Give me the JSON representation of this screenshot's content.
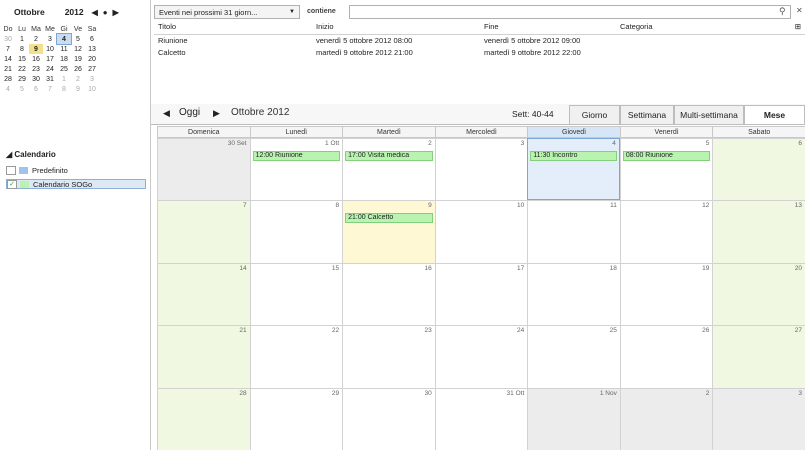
{
  "mini_cal": {
    "month": "Ottobre",
    "year": "2012",
    "weekdays": [
      "Do",
      "Lu",
      "Ma",
      "Me",
      "Gi",
      "Ve",
      "Sa"
    ],
    "rows": [
      [
        "30",
        "1",
        "2",
        "3",
        "4",
        "5",
        "6"
      ],
      [
        "7",
        "8",
        "9",
        "10",
        "11",
        "12",
        "13"
      ],
      [
        "14",
        "15",
        "16",
        "17",
        "18",
        "19",
        "20"
      ],
      [
        "21",
        "22",
        "23",
        "24",
        "25",
        "26",
        "27"
      ],
      [
        "28",
        "29",
        "30",
        "31",
        "1",
        "2",
        "3"
      ],
      [
        "4",
        "5",
        "6",
        "7",
        "8",
        "9",
        "10"
      ]
    ]
  },
  "calendars": {
    "header": "Calendario",
    "items": [
      {
        "label": "Predefinito",
        "checked": false,
        "color": "#9fc3ec"
      },
      {
        "label": "Calendario SOGo",
        "checked": true,
        "color": "#b8f4b0"
      }
    ]
  },
  "filter": {
    "selected": "Eventi nei prossimi 31 giorn..."
  },
  "search": {
    "label": "contiene",
    "value": "",
    "placeholder": ""
  },
  "list": {
    "headers": {
      "title": "Titolo",
      "start": "Inizio",
      "end": "Fine",
      "category": "Categoria"
    },
    "rows": [
      {
        "title": "Riunione",
        "start": "venerdì 5 ottobre 2012 08:00",
        "end": "venerdì 5 ottobre 2012 09:00",
        "category": ""
      },
      {
        "title": "Calcetto",
        "start": "martedì 9 ottobre 2012 21:00",
        "end": "martedì 9 ottobre 2012 22:00",
        "category": ""
      }
    ]
  },
  "view": {
    "today_label": "Oggi",
    "title": "Ottobre 2012",
    "week_range": "Sett: 40-44",
    "tabs": [
      "Giorno",
      "Settimana",
      "Multi-settimana",
      "Mese"
    ],
    "active_tab": "Mese"
  },
  "month": {
    "day_names": [
      "Domenica",
      "Lunedì",
      "Martedì",
      "Mercoledì",
      "Giovedì",
      "Venerdì",
      "Sabato"
    ],
    "weeks": [
      [
        {
          "n": "30 Set",
          "type": "other"
        },
        {
          "n": "1 Ott"
        },
        {
          "n": "2"
        },
        {
          "n": "3"
        },
        {
          "n": "4",
          "type": "today"
        },
        {
          "n": "5"
        },
        {
          "n": "6",
          "type": "weekend"
        }
      ],
      [
        {
          "n": "7",
          "type": "weekend"
        },
        {
          "n": "8"
        },
        {
          "n": "9",
          "type": "sel"
        },
        {
          "n": "10"
        },
        {
          "n": "11"
        },
        {
          "n": "12"
        },
        {
          "n": "13",
          "type": "weekend"
        }
      ],
      [
        {
          "n": "14",
          "type": "weekend"
        },
        {
          "n": "15"
        },
        {
          "n": "16"
        },
        {
          "n": "17"
        },
        {
          "n": "18"
        },
        {
          "n": "19"
        },
        {
          "n": "20",
          "type": "weekend"
        }
      ],
      [
        {
          "n": "21",
          "type": "weekend"
        },
        {
          "n": "22"
        },
        {
          "n": "23"
        },
        {
          "n": "24"
        },
        {
          "n": "25"
        },
        {
          "n": "26"
        },
        {
          "n": "27",
          "type": "weekend"
        }
      ],
      [
        {
          "n": "28",
          "type": "weekend"
        },
        {
          "n": "29"
        },
        {
          "n": "30"
        },
        {
          "n": "31 Ott"
        },
        {
          "n": "1 Nov",
          "type": "other"
        },
        {
          "n": "2",
          "type": "other"
        },
        {
          "n": "3",
          "type": "other"
        }
      ]
    ],
    "events": [
      {
        "week": 0,
        "day": 1,
        "label": "12:00 Riunione"
      },
      {
        "week": 0,
        "day": 2,
        "label": "17:00 Visita medica"
      },
      {
        "week": 0,
        "day": 4,
        "label": "11:30 Incontro"
      },
      {
        "week": 0,
        "day": 5,
        "label": "08:00 Riunione"
      },
      {
        "week": 1,
        "day": 2,
        "label": "21:00 Calcetto"
      }
    ]
  }
}
